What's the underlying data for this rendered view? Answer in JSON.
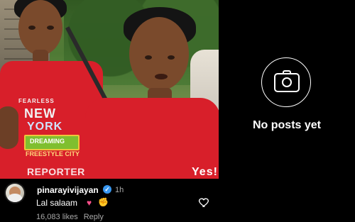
{
  "post": {
    "watermark": "REPORTER",
    "shirt_print": {
      "line1": "FEARLESS",
      "line2": "NEW",
      "line3": "YORK",
      "badge": "DREAMING",
      "line4": "FREESTYLE CITY"
    },
    "shirt_text": "Yes!",
    "caption": {
      "username": "pinarayivijayan",
      "verified_mark": "✓",
      "time_ago": "1h",
      "text": "Lal salaam",
      "emoji_heart": "♥",
      "emoji_fist": "✊",
      "likes": "16,083 likes",
      "reply": "Reply"
    }
  },
  "profile": {
    "empty_state": "No posts yet",
    "icon": "camera-icon"
  },
  "colors": {
    "background": "#000000",
    "text": "#ffffff",
    "muted": "#a8a8a8",
    "verified": "#3897f0",
    "shirt_red": "#d81f2a"
  }
}
